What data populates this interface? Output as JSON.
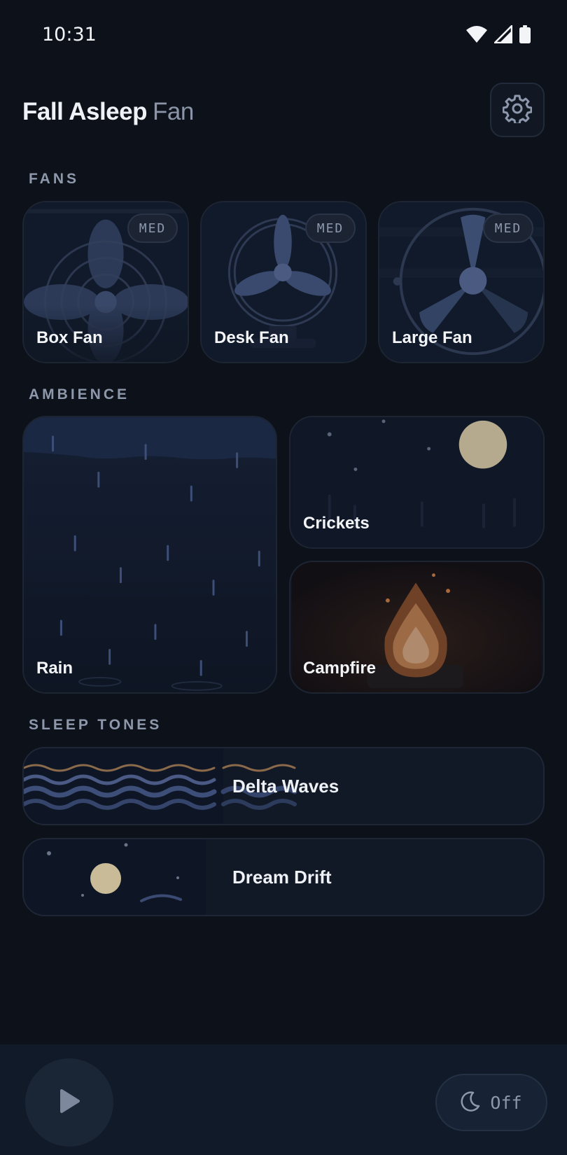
{
  "status_bar": {
    "time": "10:31"
  },
  "header": {
    "title_bold": "Fall Asleep",
    "title_light": "Fan"
  },
  "sections": {
    "fans": "FANS",
    "ambience": "AMBIENCE",
    "sleep_tones": "SLEEP TONES"
  },
  "fans": [
    {
      "label": "Box Fan",
      "speed": "MED"
    },
    {
      "label": "Desk Fan",
      "speed": "MED"
    },
    {
      "label": "Large Fan",
      "speed": "MED"
    }
  ],
  "ambience": [
    {
      "label": "Rain"
    },
    {
      "label": "Crickets"
    },
    {
      "label": "Campfire"
    }
  ],
  "sleep_tones": [
    {
      "label": "Delta Waves"
    },
    {
      "label": "Dream Drift"
    }
  ],
  "player": {
    "timer_label": "Off"
  },
  "icons": {
    "settings": "gear-icon",
    "play": "play-icon",
    "timer": "moon-icon",
    "wifi": "wifi-icon",
    "signal": "signal-icon",
    "battery": "battery-icon"
  },
  "colors": {
    "background": "#0c111a",
    "card": "#0f1623",
    "accent_blue": "#3d4f78",
    "moon": "#c9bb98",
    "fire": "#b9743e",
    "muted_text": "#8e98ab"
  }
}
